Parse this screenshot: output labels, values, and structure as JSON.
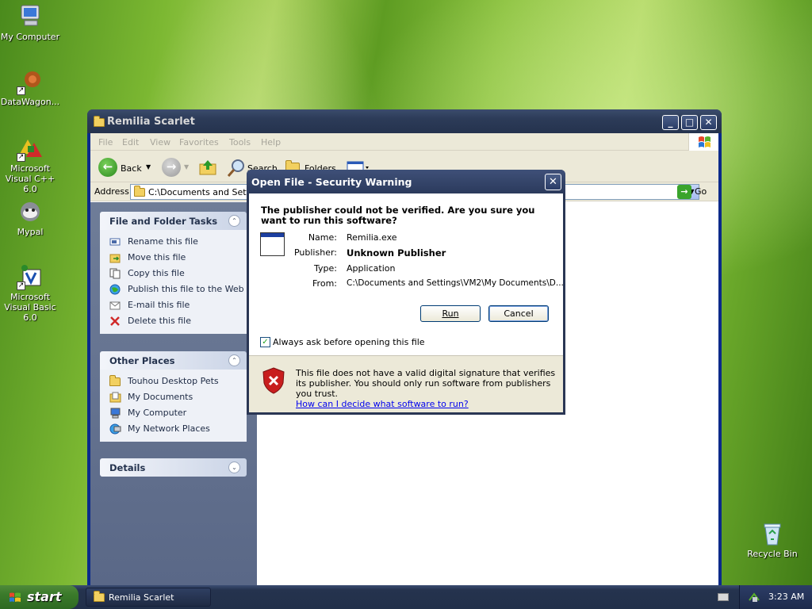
{
  "desktop": {
    "icons": [
      {
        "label": "My Computer",
        "icon": "my-computer-icon"
      },
      {
        "label": "DataWagon...",
        "icon": "datawagon-icon"
      },
      {
        "label": "Microsoft Visual C++ 6.0",
        "icon": "visual-cpp-icon"
      },
      {
        "label": "Mypal",
        "icon": "mypal-icon"
      },
      {
        "label": "Microsoft Visual Basic 6.0",
        "icon": "visual-basic-icon"
      },
      {
        "label": "Recycle Bin",
        "icon": "recycle-bin-icon"
      }
    ]
  },
  "explorer": {
    "title": "Remilia Scarlet",
    "menu": [
      "File",
      "Edit",
      "View",
      "Favorites",
      "Tools",
      "Help"
    ],
    "toolbar": {
      "back": "Back",
      "search": "Search",
      "folders": "Folders"
    },
    "address": {
      "label": "Address",
      "value": "C:\\Documents and Settings\\VM2\\My Documents\\Desktop\\Touhou Desktop Pets\\Remilia Scarlet",
      "go": "Go"
    },
    "file_tasks": {
      "header": "File and Folder Tasks",
      "items": [
        "Rename this file",
        "Move this file",
        "Copy this file",
        "Publish this file to the Web",
        "E-mail this file",
        "Delete this file"
      ]
    },
    "other_places": {
      "header": "Other Places",
      "items": [
        "Touhou Desktop Pets",
        "My Documents",
        "My Computer",
        "My Network Places"
      ]
    },
    "details": {
      "header": "Details"
    }
  },
  "dialog": {
    "title": "Open File - Security Warning",
    "question": "The publisher could not be verified.  Are you sure you want to run this software?",
    "fields": [
      {
        "label": "Name:",
        "value": "Remilia.exe"
      },
      {
        "label": "Publisher:",
        "value": "Unknown Publisher"
      },
      {
        "label": "Type:",
        "value": "Application"
      },
      {
        "label": "From:",
        "value": "C:\\Documents and Settings\\VM2\\My Documents\\D..."
      }
    ],
    "run_label": "Run",
    "cancel_label": "Cancel",
    "checkbox_label": "Always ask before opening this file",
    "checkbox_checked": true,
    "warning_text": "This file does not have a valid digital signature that verifies its publisher.  You should only run software from publishers you trust.",
    "warning_link": "How can I decide what software to run?"
  },
  "taskbar": {
    "start_label": "start",
    "tasks": [
      "Remilia Scarlet"
    ],
    "clock": "3:23 AM"
  }
}
